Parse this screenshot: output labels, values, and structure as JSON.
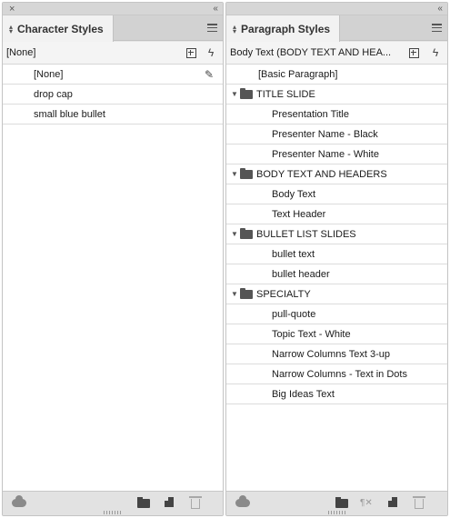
{
  "character_panel": {
    "title_bar": {
      "close_glyph": "×",
      "collapse_glyph": "‹‹"
    },
    "tab_label": "Character Styles",
    "current_style": "[None]",
    "items": [
      {
        "label": "[None]"
      },
      {
        "label": "drop cap"
      },
      {
        "label": "small blue bullet"
      }
    ],
    "footer_icons": [
      "cloud-library-icon",
      "new-folder-icon",
      "new-style-icon",
      "delete-icon"
    ]
  },
  "paragraph_panel": {
    "title_bar": {
      "collapse_glyph": "‹‹"
    },
    "tab_label": "Paragraph Styles",
    "current_style": "Body Text (BODY TEXT AND HEA...",
    "base_item": {
      "label": "[Basic Paragraph]"
    },
    "groups": [
      {
        "label": "TITLE SLIDE",
        "children": [
          "Presentation Title",
          "Presenter Name - Black",
          "Presenter Name - White"
        ]
      },
      {
        "label": "BODY TEXT AND HEADERS",
        "children": [
          "Body Text",
          "Text Header"
        ]
      },
      {
        "label": "BULLET LIST SLIDES",
        "children": [
          "bullet text",
          "bullet header"
        ]
      },
      {
        "label": "SPECIALTY",
        "children": [
          "pull-quote",
          "Topic Text - White",
          "Narrow Columns Text 3-up",
          "Narrow Columns - Text in Dots",
          "Big Ideas Text"
        ]
      }
    ],
    "footer_icons": [
      "cloud-library-icon",
      "new-folder-icon",
      "clear-overrides-icon",
      "new-style-icon",
      "delete-icon"
    ]
  }
}
